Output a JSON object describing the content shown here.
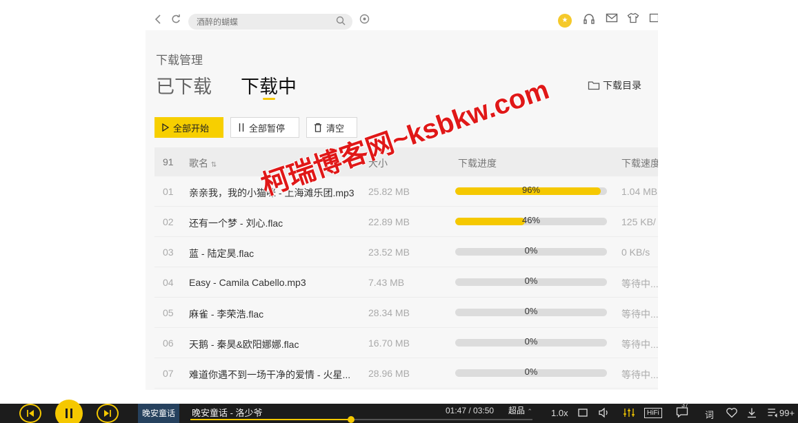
{
  "topbar": {
    "search_placeholder": "酒醉的蝴蝶"
  },
  "page": {
    "breadcrumb": "下载管理",
    "tabs": [
      {
        "label": "已下载",
        "active": false
      },
      {
        "label": "下载中",
        "active": true
      }
    ],
    "dir_link": "下载目录"
  },
  "actions": {
    "start_all": "全部开始",
    "pause_all": "全部暂停",
    "clear": "清空"
  },
  "table": {
    "count": "91",
    "col_name": "歌名",
    "col_size": "大小",
    "col_progress": "下载进度",
    "col_speed": "下载速度",
    "rows": [
      {
        "idx": "01",
        "name": "亲亲我，我的小猫咪 - 上海滩乐团.mp3",
        "size": "25.82 MB",
        "progress": 96,
        "pct": "96%",
        "speed": "1.04 MB"
      },
      {
        "idx": "02",
        "name": "还有一个梦 - 刘心.flac",
        "size": "22.89 MB",
        "progress": 46,
        "pct": "46%",
        "speed": "125 KB/"
      },
      {
        "idx": "03",
        "name": "蓝 - 陆定昊.flac",
        "size": "23.52 MB",
        "progress": 0,
        "pct": "0%",
        "speed": "0 KB/s"
      },
      {
        "idx": "04",
        "name": "Easy - Camila Cabello.mp3",
        "size": "7.43 MB",
        "progress": 0,
        "pct": "0%",
        "speed": "等待中..."
      },
      {
        "idx": "05",
        "name": "麻雀 - 李荣浩.flac",
        "size": "28.34 MB",
        "progress": 0,
        "pct": "0%",
        "speed": "等待中..."
      },
      {
        "idx": "06",
        "name": "天鹅 - 秦昊&欧阳娜娜.flac",
        "size": "16.70 MB",
        "progress": 0,
        "pct": "0%",
        "speed": "等待中..."
      },
      {
        "idx": "07",
        "name": "难道你遇不到一场干净的爱情 - 火星...",
        "size": "28.96 MB",
        "progress": 0,
        "pct": "0%",
        "speed": "等待中..."
      }
    ]
  },
  "watermark": "柯瑞博客网~ksbkw.com",
  "player": {
    "cover_text": "晚安童话",
    "track": "晚安童话 - 洛少爷",
    "time": "01:47 / 03:50",
    "played_fraction": 0.47,
    "quality": "超品",
    "speed": "1.0x",
    "hifi": "HiFi",
    "comment_count": "37",
    "lyric": "词",
    "playlist_count": "99+"
  },
  "colors": {
    "accent": "#f5c800",
    "player_bg": "#1c1c1c"
  }
}
